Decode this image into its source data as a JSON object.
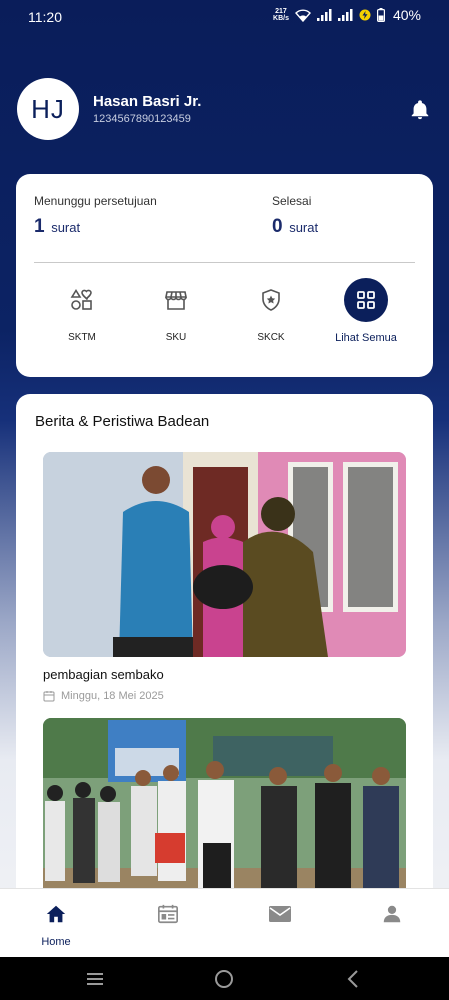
{
  "status_bar": {
    "time": "11:20",
    "net_speed_value": "217",
    "net_speed_unit": "KB/s",
    "battery": "40%"
  },
  "header": {
    "avatar_initials": "HJ",
    "name": "Hasan Basri Jr.",
    "id_number": "1234567890123459",
    "notification_icon": "bell-icon"
  },
  "summary": {
    "pending_label": "Menunggu persetujuan",
    "pending_count": "1",
    "pending_unit": "surat",
    "done_label": "Selesai",
    "done_count": "0",
    "done_unit": "surat"
  },
  "services": [
    {
      "label": "SKTM",
      "icon": "shapes-icon"
    },
    {
      "label": "SKU",
      "icon": "store-icon"
    },
    {
      "label": "SKCK",
      "icon": "shield-star-icon"
    },
    {
      "label": "Lihat Semua",
      "icon": "grid-icon"
    }
  ],
  "news": {
    "title": "Berita & Peristiwa Badean",
    "items": [
      {
        "headline": "pembagian sembako",
        "date": "Minggu, 18 Mei 2025"
      },
      {
        "headline": "",
        "date": ""
      }
    ]
  },
  "bottom_nav": [
    {
      "label": "Home",
      "icon": "home-icon",
      "active": true
    },
    {
      "label": "",
      "icon": "calendar-news-icon",
      "active": false
    },
    {
      "label": "",
      "icon": "mail-icon",
      "active": false
    },
    {
      "label": "",
      "icon": "person-icon",
      "active": false
    }
  ],
  "colors": {
    "primary": "#0b1f5b",
    "accent_text": "#1b2b6b",
    "muted": "#9a9a9a",
    "nav_inactive": "#8a8a8a"
  }
}
